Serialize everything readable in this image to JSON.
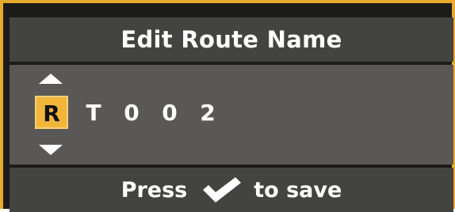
{
  "dialog": {
    "title": "Edit Route Name"
  },
  "editor": {
    "characters": [
      "R",
      "T",
      "0",
      "0",
      "2"
    ],
    "selected_index": 0,
    "up_icon": "triangle-up-icon",
    "down_icon": "triangle-down-icon"
  },
  "footer": {
    "prefix": "Press",
    "icon": "checkmark-icon",
    "suffix": "to save"
  },
  "colors": {
    "border_accent": "#e7aa2c",
    "selected_bg": "#f2b63b",
    "bar_bg": "#434341",
    "editor_bg": "#5a5856"
  }
}
